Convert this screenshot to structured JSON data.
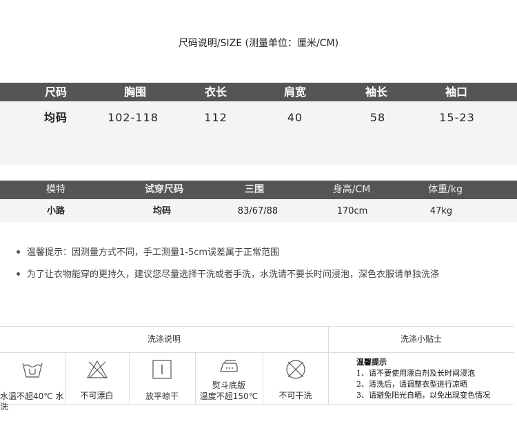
{
  "title": "尺码说明/SIZE (测量单位：厘米/CM)",
  "size_table": {
    "headers": [
      "尺码",
      "胸围",
      "衣长",
      "肩宽",
      "袖长",
      "袖口"
    ],
    "row": [
      "均码",
      "102-118",
      "112",
      "40",
      "58",
      "15-23"
    ]
  },
  "model_table": {
    "headers": [
      "模特",
      "试穿尺码",
      "三围",
      "身高/CM",
      "体重/kg"
    ],
    "row": [
      "小路",
      "均码",
      "83/67/88",
      "170cm",
      "47kg"
    ]
  },
  "notes": [
    "温馨提示：因测量方式不同，手工测量1-5cm误差属于正常范围",
    "为了让衣物能穿的更持久，建议您尽量选择干洗或者手洗，水洗请不要长时间浸泡，深色衣服请单独洗涤"
  ],
  "wash": {
    "title_left": "洗涤说明",
    "title_right": "洗涤小贴士",
    "icons": [
      {
        "icon": "wash-tub-icon",
        "label": "水温不超40℃ 水洗"
      },
      {
        "icon": "no-bleach-icon",
        "label": "不可漂白"
      },
      {
        "icon": "dry-flat-icon",
        "label": "放平晾干"
      },
      {
        "icon": "iron-icon",
        "label_line1": "熨斗底版",
        "label_line2": "温度不超150℃"
      },
      {
        "icon": "no-dry-clean-icon",
        "label": "不可干洗"
      }
    ],
    "tips_title": "温馨提示",
    "tips": [
      "1、请不要使用漂白剂及长时间浸泡",
      "2、清洗后，请调整衣型进行凉晒",
      "3、请避免阳光自晒，以免出现变色情况"
    ]
  }
}
